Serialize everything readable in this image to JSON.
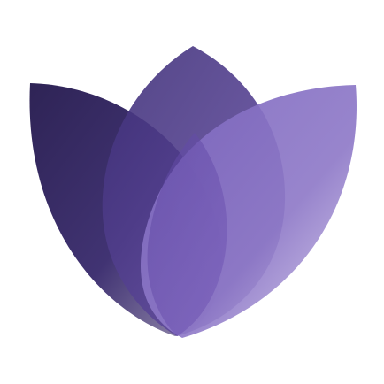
{
  "logo": {
    "icon_name": "lotus-flower-icon",
    "colors": {
      "background": "#ffffff",
      "dark_purple": "#2e2257",
      "mid_purple": "#4b3a86",
      "violet": "#6a4ea8",
      "light_violet": "#8f78c6",
      "lavender": "#c9bde6"
    }
  }
}
